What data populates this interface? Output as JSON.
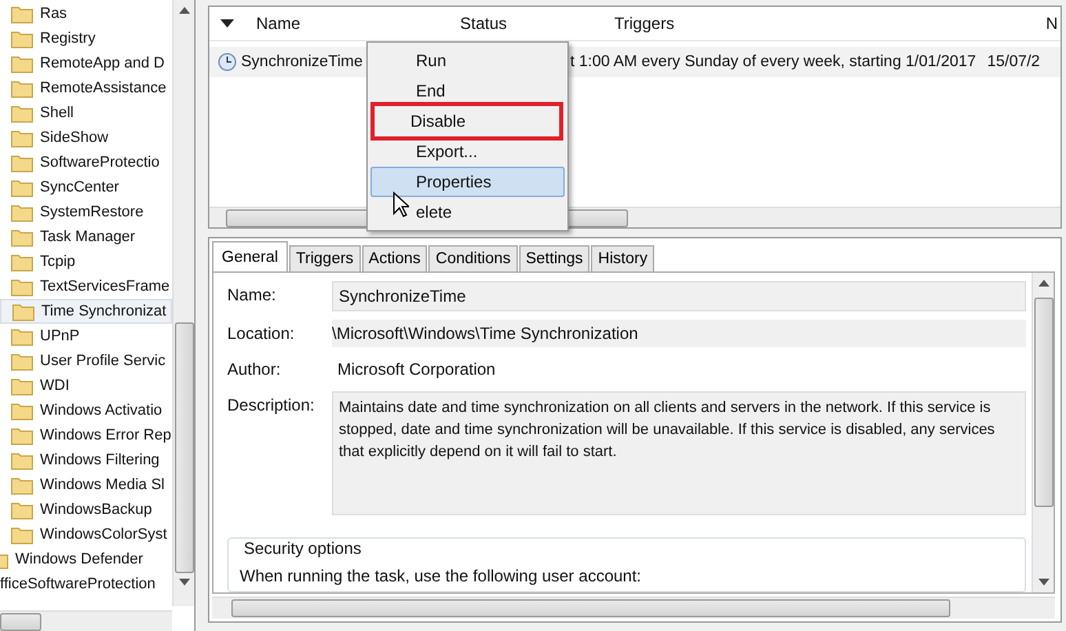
{
  "tree": {
    "items": [
      {
        "label": "Ras",
        "kind": "folder",
        "selected": false
      },
      {
        "label": "Registry",
        "kind": "folder",
        "selected": false
      },
      {
        "label": "RemoteApp and D",
        "kind": "folder",
        "selected": false
      },
      {
        "label": "RemoteAssistance",
        "kind": "folder",
        "selected": false
      },
      {
        "label": "Shell",
        "kind": "folder",
        "selected": false
      },
      {
        "label": "SideShow",
        "kind": "folder",
        "selected": false
      },
      {
        "label": "SoftwareProtectio",
        "kind": "folder",
        "selected": false
      },
      {
        "label": "SyncCenter",
        "kind": "folder",
        "selected": false
      },
      {
        "label": "SystemRestore",
        "kind": "folder",
        "selected": false
      },
      {
        "label": "Task Manager",
        "kind": "folder",
        "selected": false
      },
      {
        "label": "Tcpip",
        "kind": "folder",
        "selected": false
      },
      {
        "label": "TextServicesFrame",
        "kind": "folder",
        "selected": false
      },
      {
        "label": "Time Synchronizat",
        "kind": "folder",
        "selected": true
      },
      {
        "label": "UPnP",
        "kind": "folder",
        "selected": false
      },
      {
        "label": "User Profile Servic",
        "kind": "folder",
        "selected": false
      },
      {
        "label": "WDI",
        "kind": "folder",
        "selected": false
      },
      {
        "label": "Windows Activatio",
        "kind": "folder",
        "selected": false
      },
      {
        "label": "Windows Error Rep",
        "kind": "folder",
        "selected": false
      },
      {
        "label": "Windows Filtering",
        "kind": "folder",
        "selected": false
      },
      {
        "label": "Windows Media Sl",
        "kind": "folder",
        "selected": false
      },
      {
        "label": "WindowsBackup",
        "kind": "folder",
        "selected": false
      },
      {
        "label": "WindowsColorSyst",
        "kind": "folder",
        "selected": false
      },
      {
        "label": "Windows Defender",
        "kind": "parent-folder",
        "selected": false
      },
      {
        "label": "fficeSoftwareProtection",
        "kind": "cut-folder",
        "selected": false
      }
    ]
  },
  "task_list": {
    "columns": [
      "Name",
      "Status",
      "Triggers",
      "N"
    ],
    "rows": [
      {
        "name": "SynchronizeTime",
        "status": "",
        "triggers": "t 1:00 AM every Sunday of every week, starting 1/01/2017",
        "column_4": "15/07/2",
        "selected": true
      }
    ]
  },
  "context_menu": {
    "items": [
      {
        "label": "Run",
        "highlighted": false,
        "marked": false
      },
      {
        "label": "End",
        "highlighted": false,
        "marked": false
      },
      {
        "label": "Disable",
        "highlighted": false,
        "marked": true
      },
      {
        "label": "Export...",
        "highlighted": false,
        "marked": false
      },
      {
        "label": "Properties",
        "highlighted": true,
        "marked": false
      },
      {
        "label": "elete",
        "highlighted": false,
        "marked": false
      }
    ]
  },
  "tabs": [
    {
      "label": "General",
      "selected": true
    },
    {
      "label": "Triggers",
      "selected": false
    },
    {
      "label": "Actions",
      "selected": false
    },
    {
      "label": "Conditions",
      "selected": false
    },
    {
      "label": "Settings",
      "selected": false
    },
    {
      "label": "History",
      "selected": false
    }
  ],
  "general": {
    "name_label": "Name:",
    "name_value": "SynchronizeTime",
    "location_label": "Location:",
    "location_value": "\\Microsoft\\Windows\\Time Synchronization",
    "author_label": "Author:",
    "author_value": "Microsoft Corporation",
    "description_label": "Description:",
    "description_value": "Maintains date and time synchronization on all clients and servers in the network. If this service is stopped, date and time synchronization will be unavailable. If this service is disabled, any services that explicitly depend on it will fail to start.",
    "security_title": "Security options",
    "security_text": "When running the task, use the following user account:"
  }
}
